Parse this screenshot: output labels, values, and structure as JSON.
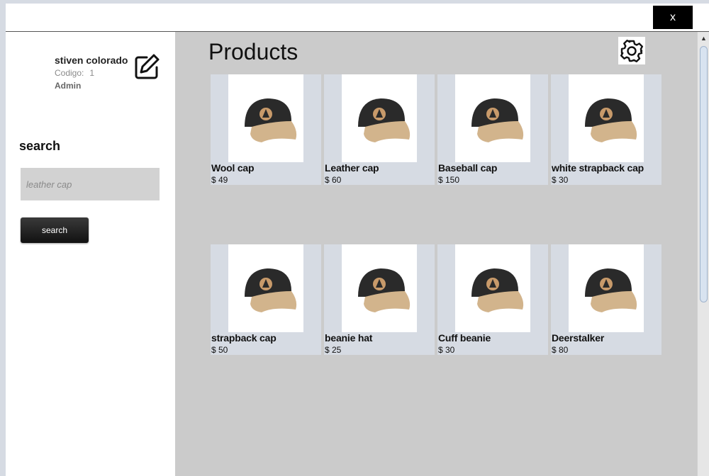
{
  "window": {
    "close_label": "x"
  },
  "user": {
    "name": "stiven colorado",
    "code_label": "Codigo:",
    "code_value": "1",
    "role": "Admin"
  },
  "search": {
    "label": "search",
    "placeholder": "leather cap",
    "button_label": "search"
  },
  "main": {
    "title": "Products"
  },
  "products": [
    {
      "name": "Wool cap",
      "price": "$ 49"
    },
    {
      "name": "Leather cap",
      "price": "$ 60"
    },
    {
      "name": "Baseball cap",
      "price": "$ 150"
    },
    {
      "name": "white strapback cap",
      "price": "$ 30"
    },
    {
      "name": "strapback cap",
      "price": "$ 50"
    },
    {
      "name": "beanie hat",
      "price": "$ 25"
    },
    {
      "name": "Cuff beanie",
      "price": "$ 30"
    },
    {
      "name": "Deerstalker",
      "price": "$ 80"
    }
  ],
  "icons": {
    "edit": "edit-icon",
    "settings": "gear-icon",
    "product_image": "cap-image"
  },
  "colors": {
    "main_bg": "#cbcbcb",
    "card_bg": "#d6dbe3",
    "close_bg": "#000000",
    "input_bg": "#d2d2d2"
  }
}
